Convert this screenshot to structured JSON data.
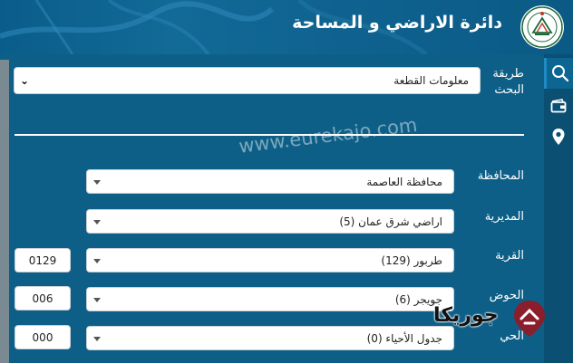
{
  "header": {
    "title": "دائرة الاراضي و المساحة",
    "logo_icon": "jordan-land-department-seal"
  },
  "sidebar": {
    "icons": [
      "search-icon",
      "wallet-icon",
      "location-pin-icon"
    ]
  },
  "search_method": {
    "label": "طريقة البحث",
    "selected": "معلومات القطعة"
  },
  "fields": {
    "governorate": {
      "label": "المحافظة",
      "selected": "محافظة العاصمة"
    },
    "directorate": {
      "label": "المديرية",
      "selected": "اراضي شرق عمان (5)"
    },
    "village": {
      "label": "القرية",
      "selected": "طربور (129)",
      "code": "0129"
    },
    "basin": {
      "label": "الحوض",
      "selected": "جويجر (6)",
      "code": "006"
    },
    "district": {
      "label": "الحي",
      "selected": "جدول الأحياء (0)",
      "code": "000"
    }
  },
  "watermark": {
    "text": "www.eurekajo.com"
  },
  "brand": {
    "text": "جوريكا"
  },
  "colors": {
    "panel": "#0d5f87",
    "header": "#0a5d8a",
    "sidebar": "#0b4f72",
    "field": "#ffffff"
  }
}
